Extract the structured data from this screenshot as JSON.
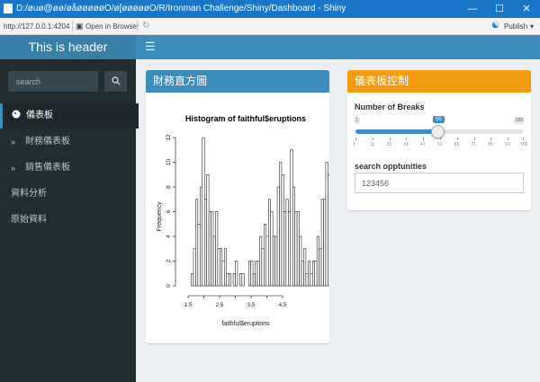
{
  "window": {
    "title": "D:/øuø@øø/øåøøøøøO/ø[øøøøøO/R/Ironman Challenge/Shiny/Dashboard - Shiny",
    "minimize": "—",
    "maximize": "☐",
    "close": "✕"
  },
  "toolbar": {
    "url": "http://127.0.0.1:4204",
    "open_browser": "Open in Browser",
    "publish": "Publish"
  },
  "header": {
    "title": "This is header",
    "toggle": "☰"
  },
  "sidebar": {
    "search_placeholder": "search",
    "search_icon": "search-icon",
    "items": [
      {
        "label": "儀表板",
        "icon": "dashboard-icon",
        "active": true
      },
      {
        "label": "財務儀表板",
        "icon": "double-chevron-icon"
      },
      {
        "label": "銷售儀表板",
        "icon": "double-chevron-icon"
      },
      {
        "label": "資料分析"
      },
      {
        "label": "原始資料"
      }
    ]
  },
  "hist_box": {
    "title": "財務直方圖",
    "header_color": "#3c8dbc"
  },
  "control_box": {
    "title": "儀表板控制",
    "header_color": "#f39c12",
    "breaks_label": "Number of Breaks",
    "slider": {
      "min": "1",
      "max": "100",
      "value": "50",
      "ticks": [
        "1",
        "11",
        "21",
        "31",
        "41",
        "51",
        "61",
        "71",
        "81",
        "91",
        "100"
      ]
    },
    "search_label": "search opptunities",
    "search_value": "123456"
  },
  "chart_data": {
    "type": "bar",
    "title": "Histogram of faithful$eruptions",
    "xlabel": "faithful$eruptions",
    "ylabel": "Frequency",
    "xlim": [
      1.5,
      5.1
    ],
    "ylim": [
      0,
      12
    ],
    "xticks": [
      "1.5",
      "2.5",
      "3.5",
      "4.5"
    ],
    "yticks": [
      "0",
      "2",
      "4",
      "6",
      "8",
      "10",
      "12"
    ],
    "bin_start": 1.6,
    "bin_width": 0.07,
    "values": [
      1,
      3,
      7,
      5,
      8,
      12,
      7,
      9,
      6,
      6,
      4,
      6,
      3,
      3,
      2,
      3,
      1,
      1,
      0,
      1,
      2,
      0,
      1,
      1,
      0,
      0,
      2,
      2,
      1,
      2,
      2,
      4,
      3,
      5,
      4,
      7,
      6,
      4,
      4,
      8,
      10,
      9,
      6,
      7,
      6,
      11,
      8,
      6,
      6,
      4,
      2,
      3,
      1,
      2,
      1,
      2,
      2,
      4,
      3,
      7,
      7,
      10,
      9,
      10,
      9,
      11,
      5,
      9,
      7,
      8,
      6,
      5,
      5,
      4,
      3,
      4,
      3,
      1,
      3,
      2,
      1,
      2,
      1,
      0,
      1,
      1,
      2
    ]
  }
}
